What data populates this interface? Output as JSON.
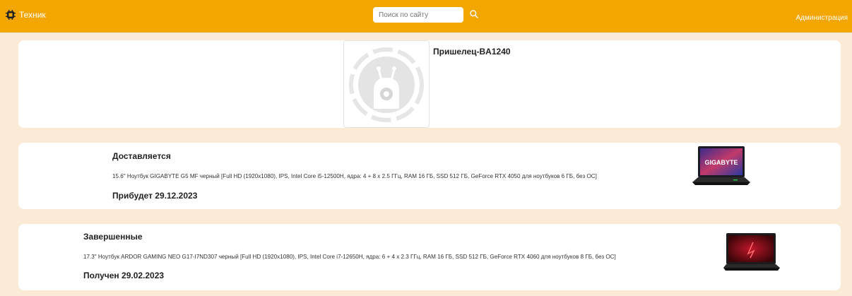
{
  "header": {
    "brand_label": "Техник",
    "search": {
      "placeholder": "Поиск по сайту",
      "value": ""
    },
    "admin_label": "Администрация"
  },
  "profile": {
    "name": "Пришелец-BA1240"
  },
  "orders": [
    {
      "status": "Доставляется",
      "description": "15.6\" Ноутбук GIGABYTE G5 MF черный [Full HD (1920x1080), IPS, Intel Core i5-12500H, ядра: 4 + 8 х 2.5 ГГц, RAM 16 ГБ, SSD 512 ГБ, GeForce RTX 4050 для ноутбуков 6 ГБ, без ОС]",
      "date_text": "Прибудет 29.12.2023",
      "image_brand": "GIGABYTE"
    },
    {
      "status": "Завершенные",
      "description": "17.3\" Ноутбук ARDOR GAMING NEO G17-I7ND307 черный [Full HD (1920x1080), IPS, Intel Core i7-12650H, ядра: 6 + 4 х 2.3 ГГц, RAM 16 ГБ, SSD 512 ГБ, GeForce RTX 4060 для ноутбуков 8 ГБ, без ОС]",
      "date_text": "Получен 29.02.2023"
    }
  ],
  "colors": {
    "header_bg": "#f3a500",
    "page_bg": "#fbead6",
    "card_bg": "#ffffff"
  }
}
